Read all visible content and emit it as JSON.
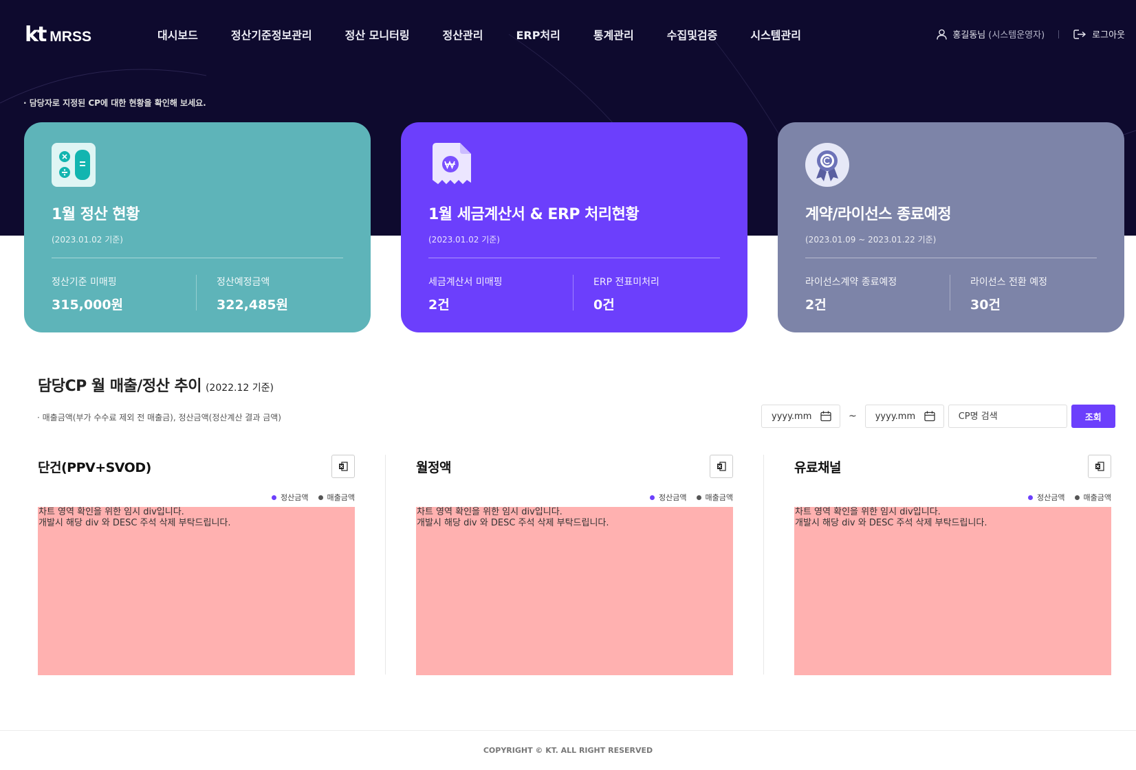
{
  "brand": {
    "kt": "kt",
    "name": "MRSS"
  },
  "nav": {
    "items": [
      {
        "label": "대시보드"
      },
      {
        "label": "정산기준정보관리"
      },
      {
        "label": "정산 모니터링"
      },
      {
        "label": "정산관리"
      },
      {
        "label": "ERP처리"
      },
      {
        "label": "통계관리"
      },
      {
        "label": "수집및검증"
      },
      {
        "label": "시스템관리"
      }
    ]
  },
  "user": {
    "name": "홍길동님",
    "role": "(시스템운영자)",
    "logout": "로그아웃"
  },
  "hero": {
    "desc": "· 담당자로 지정된 CP에 대한 현황을 확인해 보세요."
  },
  "cards": [
    {
      "title": "1월 정산 현황",
      "date": "(2023.01.02 기준)",
      "icon": "calculator-icon",
      "color": "#5eb4b9",
      "stats": [
        {
          "label": "정산기준 미매핑",
          "value": "315,000원"
        },
        {
          "label": "정산예정금액",
          "value": "322,485원"
        }
      ]
    },
    {
      "title": "1월 세금계산서 & ERP 처리현황",
      "date": "(2023.01.02 기준)",
      "icon": "receipt-won-icon",
      "color": "#6c3ffc",
      "stats": [
        {
          "label": "세금계산서 미매핑",
          "value": "2건"
        },
        {
          "label": "ERP 전표미처리",
          "value": "0건"
        }
      ]
    },
    {
      "title": "계약/라이선스 종료예정",
      "date": "(2023.01.09 ~ 2023.01.22 기준)",
      "icon": "award-badge-icon",
      "color": "#7d84a8",
      "stats": [
        {
          "label": "라이선스계약 종료예정",
          "value": "2건"
        },
        {
          "label": "라이선스 전환 예정",
          "value": "30건"
        }
      ]
    }
  ],
  "section": {
    "title": "담당CP 월 매출/정산 추이",
    "base": "(2022.12 기준)",
    "desc": "· 매출금액(부가 수수료 제외 전 매출금), 정산금액(정산계산 결과 금액)"
  },
  "filters": {
    "from_placeholder": "yyyy.mm",
    "tilde": "~",
    "to_placeholder": "yyyy.mm",
    "search_placeholder": "CP명 검색",
    "search_button": "조회"
  },
  "legend": {
    "settle": "정산금액",
    "sales": "매출금액",
    "settle_color": "#6c3ffc",
    "sales_color": "#555555"
  },
  "panels": [
    {
      "title": "단건(PPV+SVOD)",
      "placeholder_line1": "차트 영역 확인을 위한 임시 div입니다.",
      "placeholder_line2": "개발시 해당 div 와 DESC 주석 삭제 부탁드립니다."
    },
    {
      "title": "월정액",
      "placeholder_line1": "차트 영역 확인을 위한 임시 div입니다.",
      "placeholder_line2": "개발시 해당 div 와 DESC 주석 삭제 부탁드립니다."
    },
    {
      "title": "유료채널",
      "placeholder_line1": "차트 영역 확인을 위한 임시 div입니다.",
      "placeholder_line2": "개발시 해당 div 와 DESC 주석 삭제 부탁드립니다."
    }
  ],
  "footer": {
    "copyright": "COPYRIGHT © KT. ALL RIGHT RESERVED"
  }
}
